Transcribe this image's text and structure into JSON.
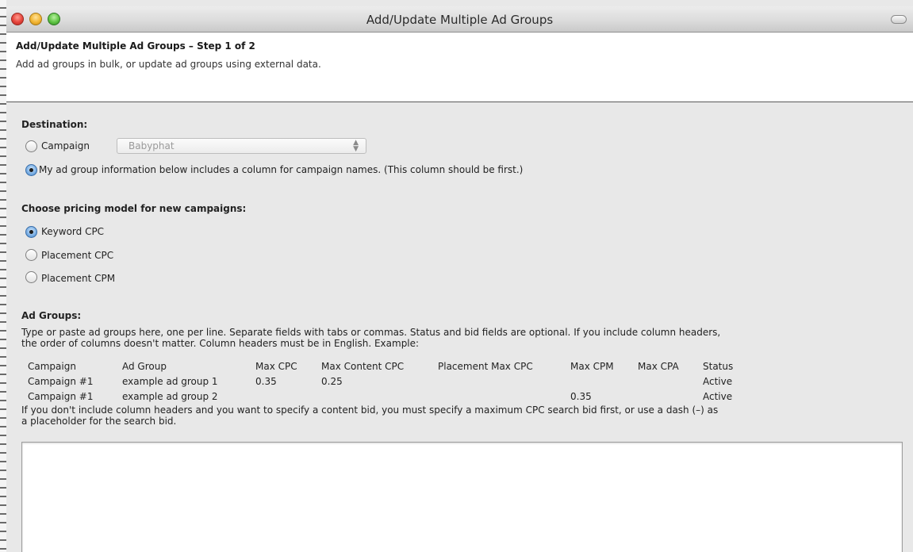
{
  "window": {
    "title": "Add/Update Multiple Ad Groups"
  },
  "header": {
    "step_title": "Add/Update Multiple Ad Groups – Step 1 of 2",
    "description": "Add ad groups in bulk, or update ad groups using external data."
  },
  "destination": {
    "label": "Destination:",
    "campaign_option": "Campaign",
    "campaign_select_value": "Babyphat",
    "column_option": "My ad group information below includes a column for campaign names. (This column should be first.)",
    "selected": "column"
  },
  "pricing": {
    "label": "Choose pricing model for new campaigns:",
    "options": [
      "Keyword CPC",
      "Placement CPC",
      "Placement CPM"
    ],
    "selected": "Keyword CPC"
  },
  "ad_groups": {
    "label": "Ad Groups:",
    "instructions_line1": "Type or paste ad groups here, one per line. Separate fields with tabs or commas. Status and bid fields are optional. If you include column headers,",
    "instructions_line2": "the order of columns doesn't matter. Column headers must be in English. Example:",
    "example_headers": [
      "Campaign",
      "Ad Group",
      "Max CPC",
      "Max Content CPC",
      "Placement Max CPC",
      "Max CPM",
      "Max CPA",
      "Status"
    ],
    "example_rows": [
      [
        "Campaign #1",
        "example ad group 1",
        "0.35",
        "0.25",
        "",
        "",
        "",
        "Active"
      ],
      [
        "Campaign #1",
        "example ad group 2",
        "",
        "",
        "",
        "0.35",
        "",
        "Active"
      ]
    ],
    "note_line1": "If you don't include column headers and you want to specify a content bid, you must specify a maximum CPC search bid first, or use a dash (–) as",
    "note_line2": "a placeholder for the search bid.",
    "textarea_value": ""
  },
  "colors": {
    "selected_radio": "#3f7ec2",
    "dialog_background": "#e8e8e8",
    "header_background": "#ffffff"
  }
}
